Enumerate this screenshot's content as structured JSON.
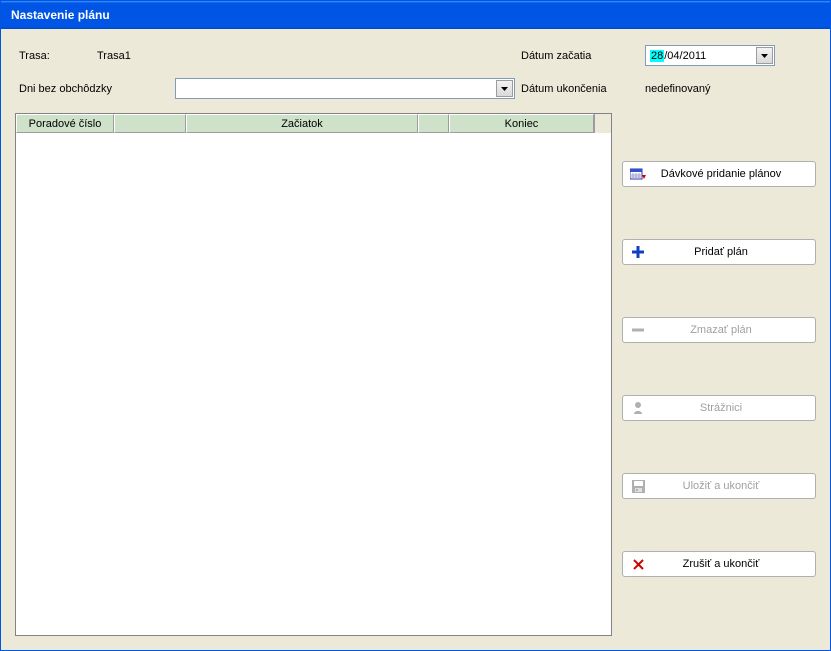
{
  "window": {
    "title": "Nastavenie plánu"
  },
  "form": {
    "trasa_label": "Trasa:",
    "trasa_value": "Trasa1",
    "dni_label": "Dni bez obchôdzky",
    "dni_value": "",
    "datum_zaciatia_label": "Dátum začatia",
    "datum_zaciatia_day": "28",
    "datum_zaciatia_rest": "/04/2011",
    "datum_ukoncenia_label": "Dátum ukončenia",
    "datum_ukoncenia_value": "nedefinovaný"
  },
  "table": {
    "col_seq": "Poradové číslo",
    "col_blank": "",
    "col_start": "Začiatok",
    "col_blank2": "",
    "col_end": "Koniec"
  },
  "buttons": {
    "batch_add": "Dávkové pridanie plánov",
    "add_plan": "Pridať plán",
    "delete_plan": "Zmazať plán",
    "guards": "Strážnici",
    "save_exit": "Uložiť a ukončiť",
    "cancel_exit": "Zrušiť a ukončiť"
  }
}
